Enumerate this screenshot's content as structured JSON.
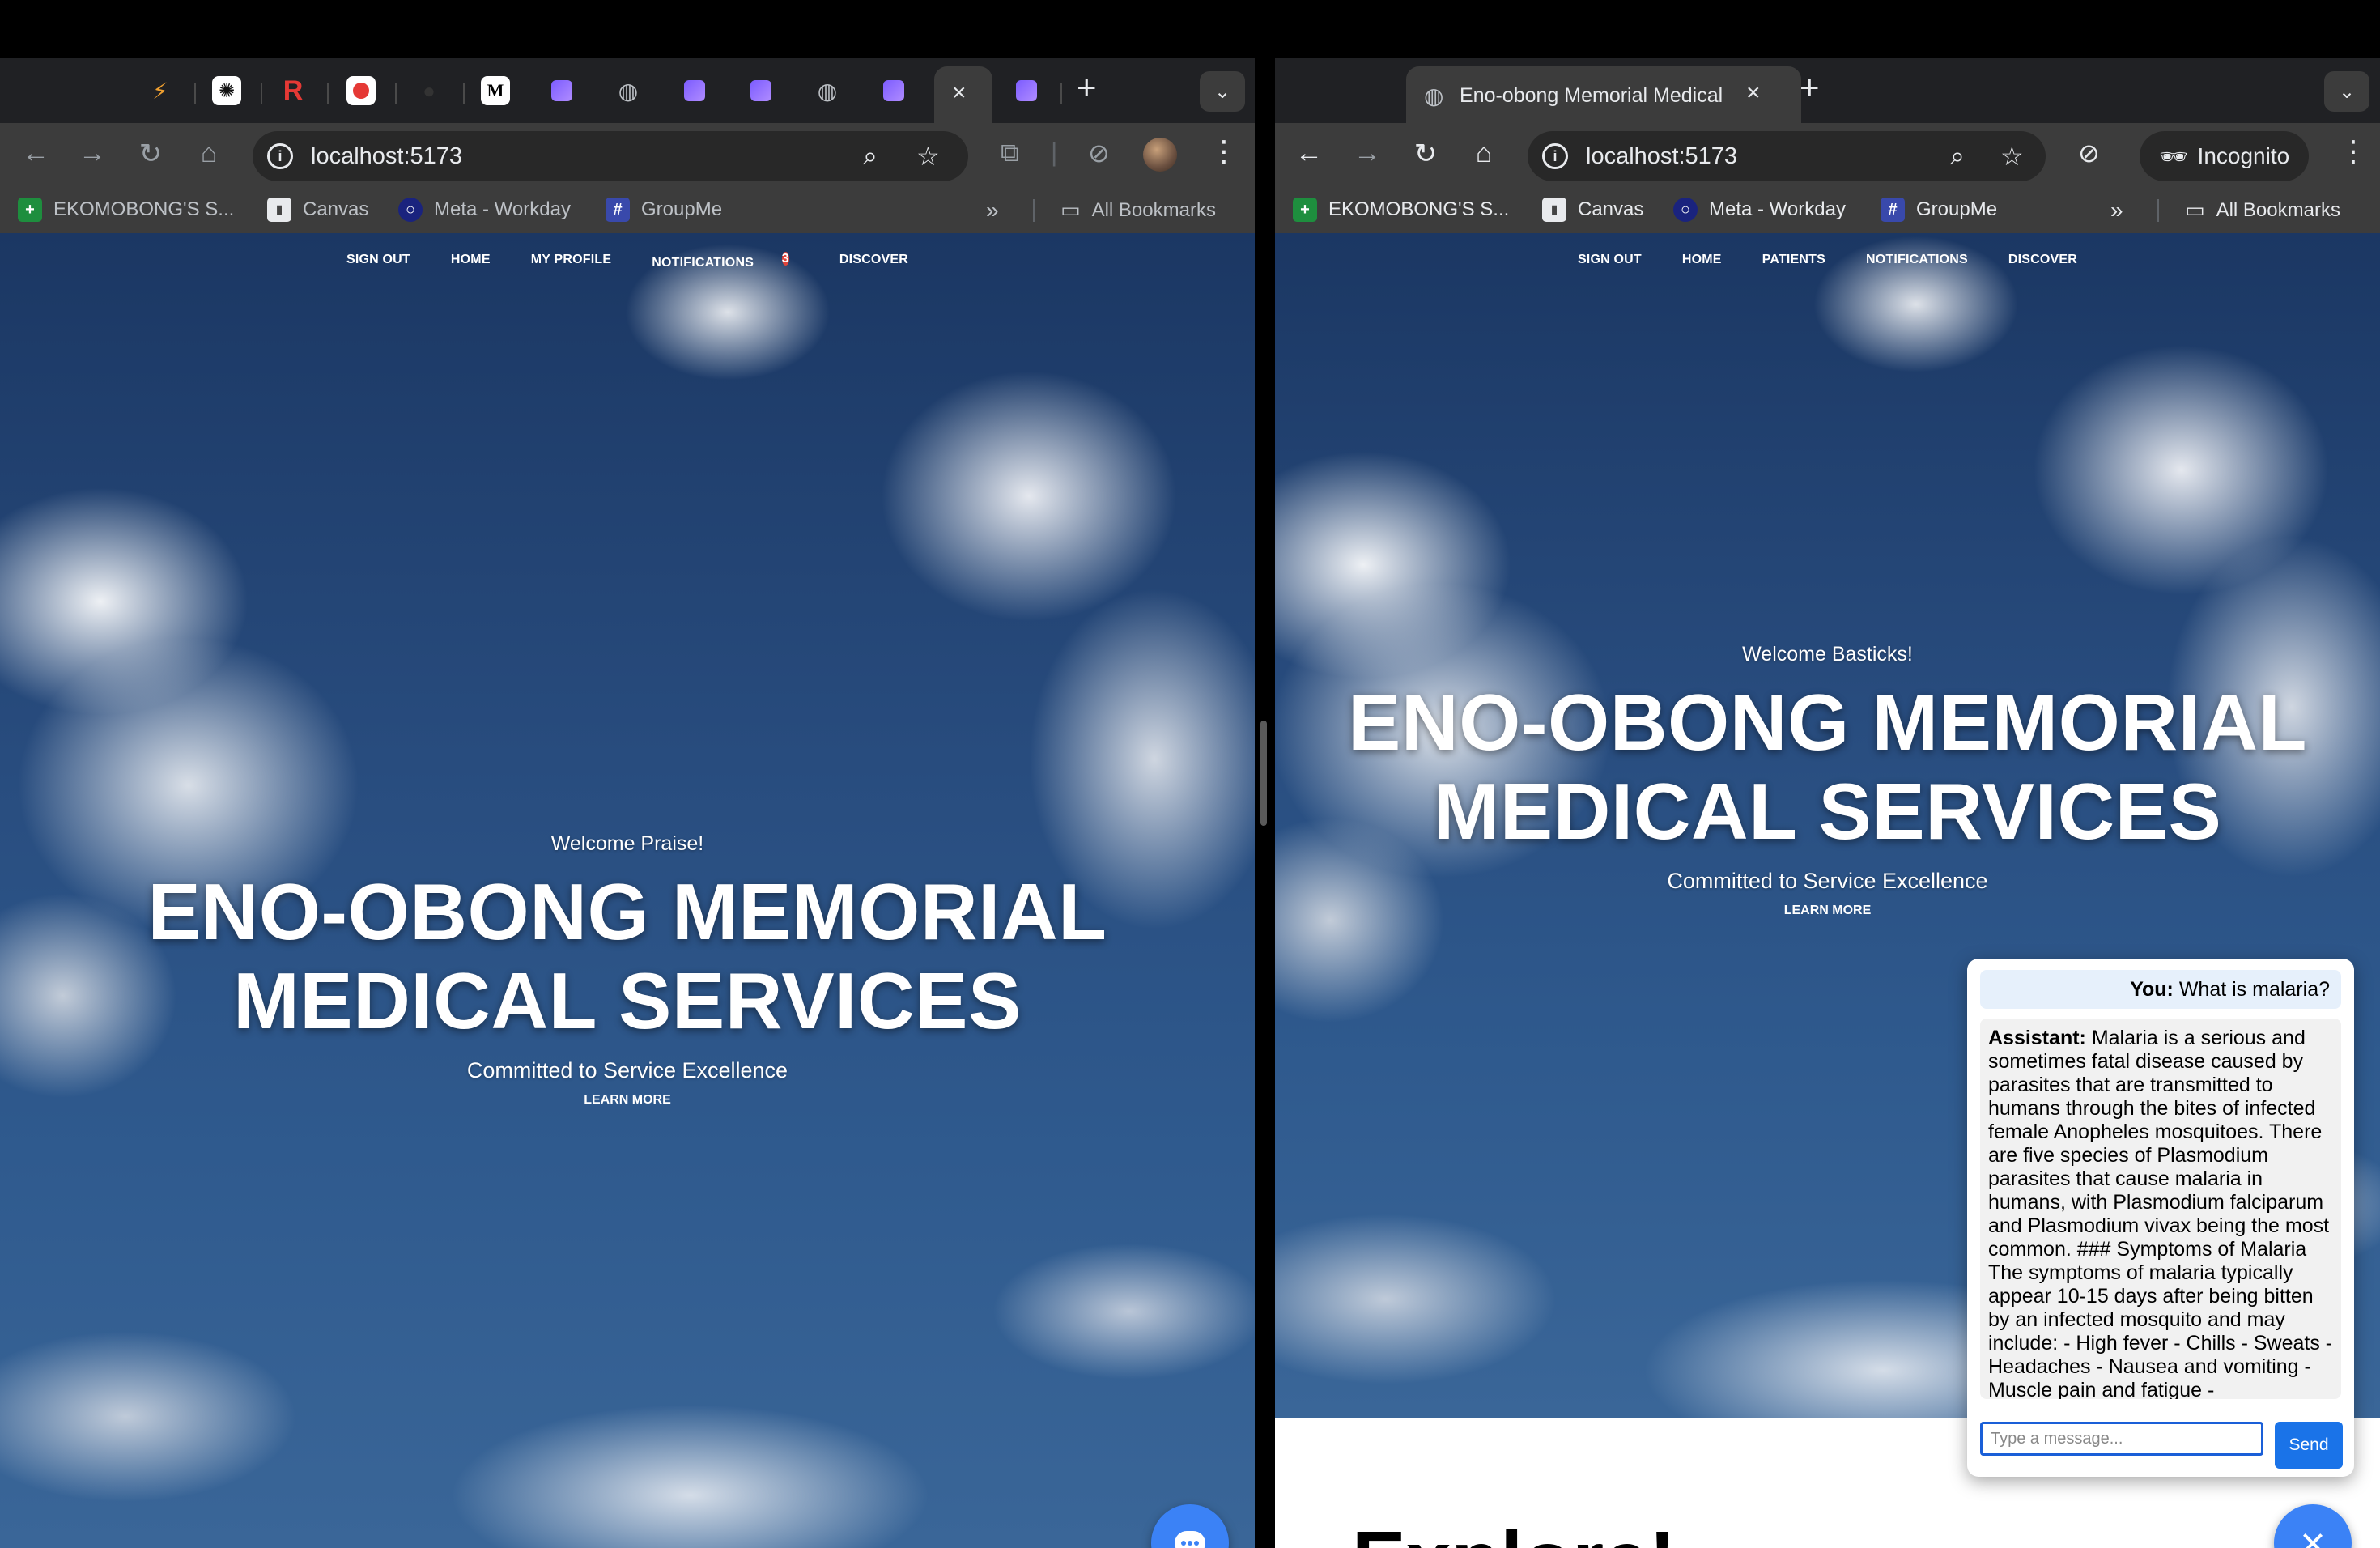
{
  "left": {
    "tabs": {
      "active_close": "×",
      "new_tab": "+"
    },
    "url": "localhost:5173",
    "bookmarks": [
      "EKOMOBONG'S S...",
      "Canvas",
      "Meta - Workday",
      "GroupMe"
    ],
    "all_bookmarks": "All Bookmarks",
    "nav": {
      "sign_out": "SIGN OUT",
      "home": "HOME",
      "my_profile": "MY PROFILE",
      "notifications": "NOTIFICATIONS",
      "notifications_count": "3",
      "discover": "DISCOVER"
    },
    "hero": {
      "welcome": "Welcome Praise!",
      "title_line1": "ENO-OBONG MEMORIAL",
      "title_line2": "MEDICAL SERVICES",
      "tagline": "Committed to Service Excellence",
      "learn_more": "LEARN MORE"
    }
  },
  "right": {
    "tab_title": "Eno-obong Memorial Medical Services",
    "tab_close": "×",
    "new_tab": "+",
    "url": "localhost:5173",
    "incognito_label": "Incognito",
    "bookmarks": [
      "EKOMOBONG'S S...",
      "Canvas",
      "Meta - Workday",
      "GroupMe"
    ],
    "all_bookmarks": "All Bookmarks",
    "nav": {
      "sign_out": "SIGN OUT",
      "home": "HOME",
      "patients": "PATIENTS",
      "notifications": "NOTIFICATIONS",
      "discover": "DISCOVER"
    },
    "hero": {
      "welcome": "Welcome Basticks!",
      "title_line1": "ENO-OBONG MEMORIAL",
      "title_line2": "MEDICAL SERVICES",
      "tagline": "Committed to Service Excellence",
      "learn_more": "LEARN MORE"
    },
    "explore_heading": "Explore!",
    "chat": {
      "user_label": "You:",
      "user_message": "What is malaria?",
      "assistant_label": "Assistant:",
      "assistant_message": "Malaria is a serious and sometimes fatal disease caused by parasites that are transmitted to humans through the bites of infected female Anopheles mosquitoes. There are five species of Plasmodium parasites that cause malaria in humans, with Plasmodium falciparum and Plasmodium vivax being the most common. ### Symptoms of Malaria The symptoms of malaria typically appear 10-15 days after being bitten by an infected mosquito and may include: - High fever - Chills - Sweats - Headaches - Nausea and vomiting - Muscle pain and fatigue -",
      "input_placeholder": "Type a message...",
      "send_label": "Send",
      "close_fab": "×"
    }
  },
  "colors": {
    "accent_blue": "#3b82f6",
    "badge_red": "#e0443a",
    "chrome_dark": "#202124",
    "chrome_toolbar": "#3c3c3c"
  }
}
